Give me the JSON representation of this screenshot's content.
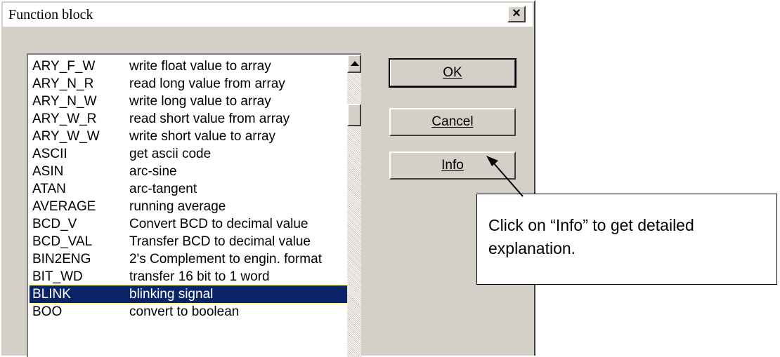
{
  "dialog": {
    "title": "Function block",
    "close_label": "×"
  },
  "list": {
    "items": [
      {
        "name": "ARY_F_W",
        "desc": "write float value to array"
      },
      {
        "name": "ARY_N_R",
        "desc": "read long value from array"
      },
      {
        "name": "ARY_N_W",
        "desc": "write long value to array"
      },
      {
        "name": "ARY_W_R",
        "desc": "read short value from array"
      },
      {
        "name": "ARY_W_W",
        "desc": "write short value to array"
      },
      {
        "name": "ASCII",
        "desc": "get ascii code"
      },
      {
        "name": "ASIN",
        "desc": "arc-sine"
      },
      {
        "name": "ATAN",
        "desc": "arc-tangent"
      },
      {
        "name": "AVERAGE",
        "desc": "running average"
      },
      {
        "name": "BCD_V",
        "desc": "Convert BCD to decimal value"
      },
      {
        "name": "BCD_VAL",
        "desc": "Transfer BCD to decimal value"
      },
      {
        "name": "BIN2ENG",
        "desc": "2's Complement to engin. format"
      },
      {
        "name": "BIT_WD",
        "desc": "transfer 16 bit to 1 word"
      },
      {
        "name": "BLINK",
        "desc": "blinking signal",
        "selected": true
      },
      {
        "name": "BOO",
        "desc": "convert to boolean"
      }
    ]
  },
  "buttons": {
    "ok": "OK",
    "cancel": "Cancel",
    "info": "Info"
  },
  "callout": {
    "text": "Click on “Info” to get detailed explanation."
  },
  "colors": {
    "dialog_bg": "#d4d0c8",
    "selection": "#0a246a"
  }
}
